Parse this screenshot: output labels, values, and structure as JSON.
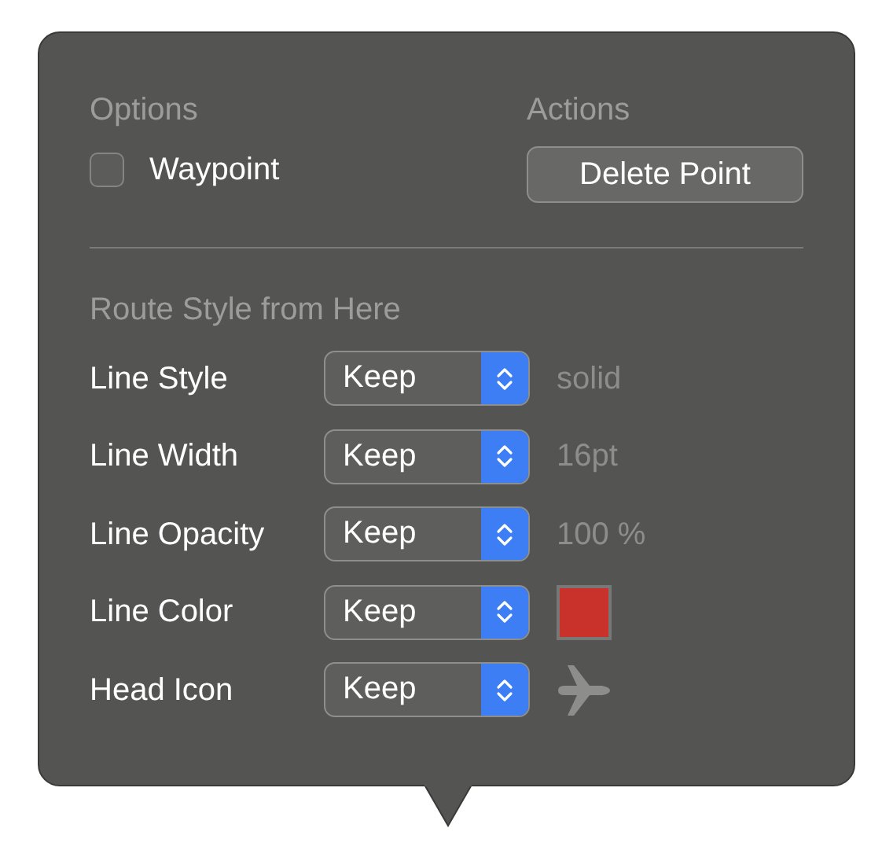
{
  "options": {
    "title": "Options",
    "waypoint": {
      "label": "Waypoint",
      "checked": false
    }
  },
  "actions": {
    "title": "Actions",
    "button": "Delete Point"
  },
  "route_style": {
    "title": "Route Style from Here",
    "rows": [
      {
        "label": "Line Style",
        "value": "Keep",
        "kind": "text",
        "reading": "solid"
      },
      {
        "label": "Line Width",
        "value": "Keep",
        "kind": "text",
        "reading": "16pt"
      },
      {
        "label": "Line Opacity",
        "value": "Keep",
        "kind": "text",
        "reading": "100 %"
      },
      {
        "label": "Line Color",
        "value": "Keep",
        "kind": "color",
        "color": "#c8322a"
      },
      {
        "label": "Head Icon",
        "value": "Keep",
        "kind": "icon"
      }
    ]
  }
}
